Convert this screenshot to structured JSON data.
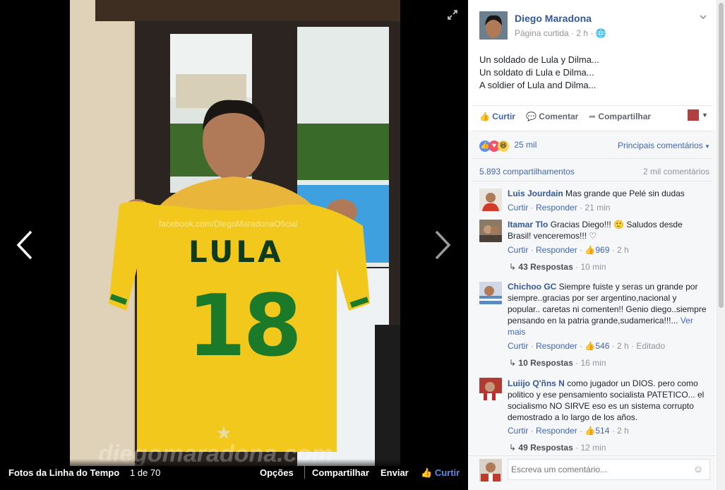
{
  "viewer": {
    "album_title": "Fotos da Linha do Tempo",
    "counter": "1 de 70",
    "options": "Opções",
    "share": "Compartilhar",
    "send": "Enviar",
    "like": "Curtir",
    "watermark_top": "facebook.com/DiegoMaradonaOficial",
    "watermark_bottom": "diegomaradona.com",
    "shirt_name": "LULA",
    "shirt_number": "18"
  },
  "post": {
    "author": "Diego Maradona",
    "meta": "Página curtida · 2 h ·",
    "lines": [
      "Un soldado de Lula y Dilma...",
      "Un soldato di Lula e Dilma...",
      "A soldier of Lula and Dilma..."
    ],
    "actions": {
      "like": "Curtir",
      "comment": "Comentar",
      "share": "Compartilhar"
    },
    "reactions_count": "25 mil",
    "sort_label": "Principais comentários",
    "shares": "5.893 compartilhamentos",
    "comments_count": "2 mil comentários"
  },
  "comments": [
    {
      "name": "Luis Jourdain",
      "text": "Mas grande que Pelé sin dudas",
      "reply": "Curtir",
      "respond": "Responder",
      "time": "21 min"
    },
    {
      "name": "Itamar Tlo",
      "text": "Gracias Diego!!! 🙂 Saludos desde Brasil! venceremos!!! ♡",
      "reply": "Curtir",
      "respond": "Responder",
      "likes": "969",
      "time": "2 h",
      "replies": "43 Respostas",
      "replies_time": "10 min"
    },
    {
      "name": "Chichoo GC",
      "text": "Siempre fuiste y seras un grande por siempre..gracias por ser argentino,nacional y popular.. caretas ni comenten!! Genio diego..siempre pensando en la patria grande,sudamerica!!!...",
      "more": "Ver mais",
      "reply": "Curtir",
      "respond": "Responder",
      "likes": "546",
      "time": "2 h",
      "edited": "Editado",
      "replies": "10 Respostas",
      "replies_time": "16 min"
    },
    {
      "name": "Luiijo Q'ñns N",
      "text": "como jugador un DIOS. pero como politico y ese pensamiento socialista PATETICO... el socialismo NO SIRVE eso es un sistema corrupto demostrado a lo largo de los años.",
      "reply": "Curtir",
      "respond": "Responder",
      "likes": "514",
      "time": "2 h",
      "replies": "49 Respostas",
      "replies_time": "12 min"
    }
  ],
  "composer": {
    "placeholder": "Escreva um comentário..."
  },
  "colors": {
    "accent": "#365899",
    "like_blue": "#4267b2",
    "shirt_yellow": "#f2c81d",
    "shirt_green": "#1a7a2a"
  }
}
